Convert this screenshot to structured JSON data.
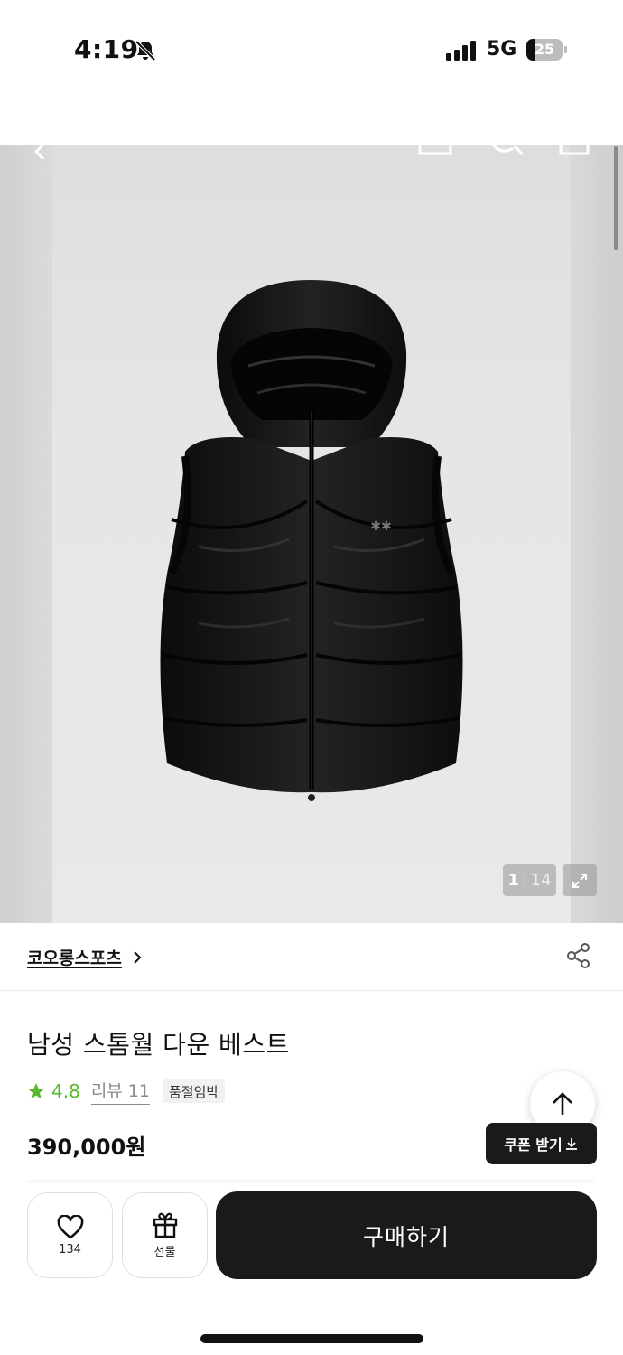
{
  "status_bar": {
    "time": "4:19",
    "network": "5G",
    "battery_percent": "25",
    "battery_level": 0.25
  },
  "gallery": {
    "current_index": "1",
    "separator": "|",
    "total": "14"
  },
  "brand": {
    "name": "코오롱스포츠"
  },
  "product": {
    "title": "남성 스톰월 다운 베스트",
    "rating": "4.8",
    "review_label": "리뷰 11",
    "stock_badge": "품절임박",
    "price": "390,000원"
  },
  "coupon": {
    "label": "쿠폰 받기"
  },
  "bottom_bar": {
    "wish_count": "134",
    "gift_label": "선물",
    "buy_label": "구매하기"
  },
  "colors": {
    "accent_green": "#5ab82e",
    "dark": "#1a1a1a"
  },
  "icons": [
    "bell-slash-icon",
    "signal-icon",
    "battery-icon",
    "back-icon",
    "cart-icon",
    "search-icon",
    "home-icon",
    "expand-icon",
    "chevron-right-icon",
    "share-icon",
    "star-icon",
    "arrow-up-icon",
    "heart-icon",
    "gift-icon",
    "download-icon"
  ]
}
